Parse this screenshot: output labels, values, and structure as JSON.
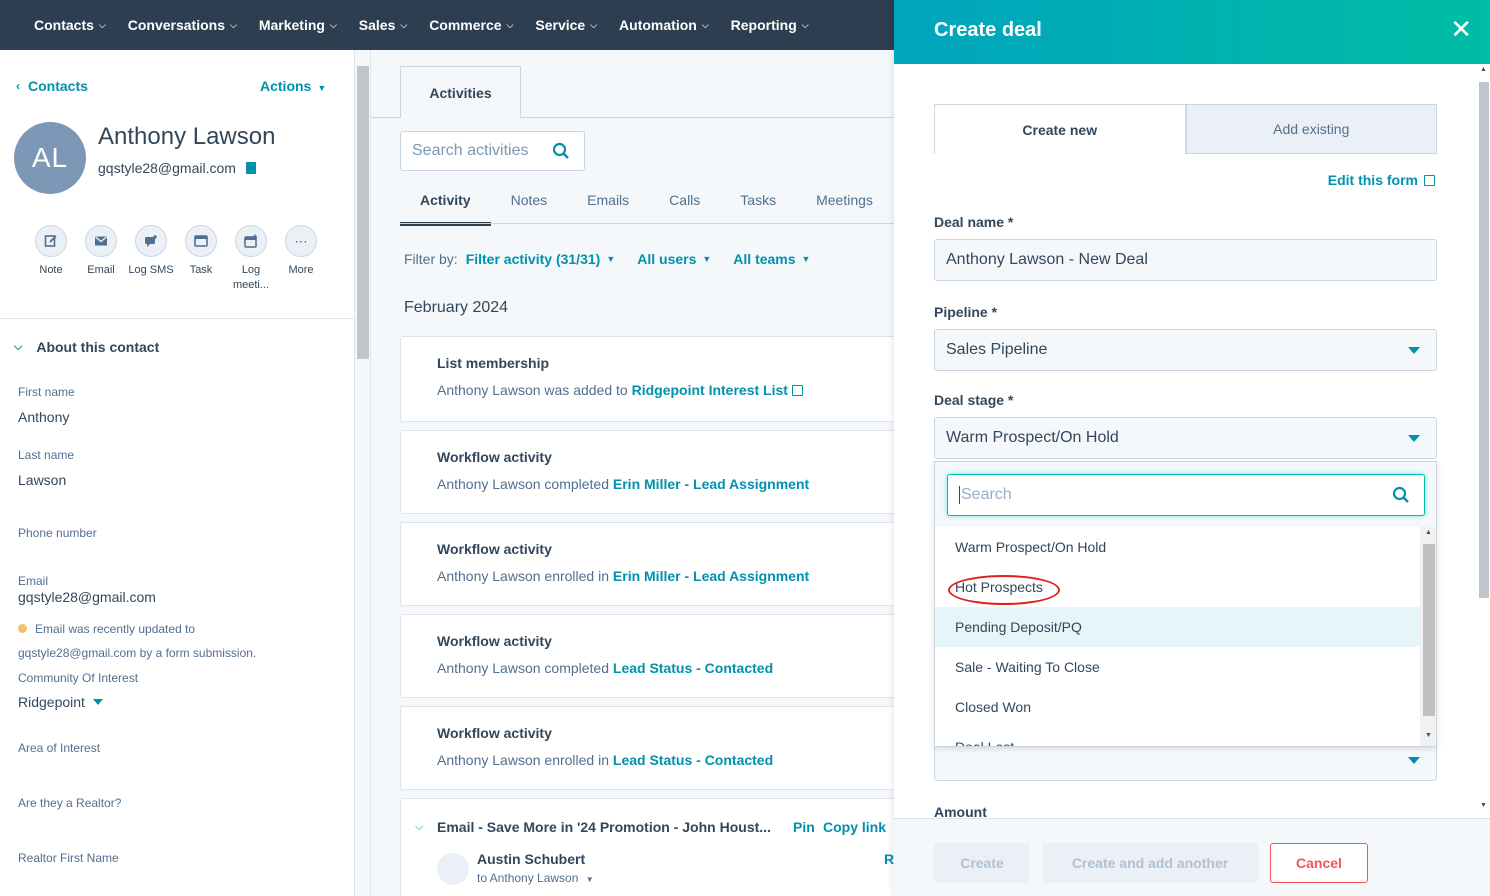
{
  "topnav": {
    "items": [
      "Contacts",
      "Conversations",
      "Marketing",
      "Sales",
      "Commerce",
      "Service",
      "Automation",
      "Reporting"
    ]
  },
  "contact": {
    "breadcrumb": "Contacts",
    "actions_label": "Actions",
    "initials": "AL",
    "name": "Anthony Lawson",
    "email": "gqstyle28@gmail.com"
  },
  "quick_actions": [
    {
      "label": "Note",
      "icon": "note-icon"
    },
    {
      "label": "Email",
      "icon": "email-icon"
    },
    {
      "label": "Log SMS",
      "icon": "log-sms-icon"
    },
    {
      "label": "Task",
      "icon": "task-icon"
    },
    {
      "label": "Log meeti...",
      "icon": "log-meeting-icon"
    },
    {
      "label": "More",
      "icon": "more-icon"
    }
  ],
  "about": {
    "heading": "About this contact",
    "first_name_label": "First name",
    "first_name": "Anthony",
    "last_name_label": "Last name",
    "last_name": "Lawson",
    "phone_label": "Phone number",
    "email_label": "Email",
    "email": "gqstyle28@gmail.com",
    "email_note_line1": "Email was recently updated to",
    "email_note_line2": "gqstyle28@gmail.com by a form submission.",
    "community_label": "Community Of Interest",
    "community": "Ridgepoint",
    "area_label": "Area of Interest",
    "realtor_label": "Are they a Realtor?",
    "realtor_first_label": "Realtor First Name"
  },
  "activities": {
    "tab": "Activities",
    "search_placeholder": "Search activities",
    "subtabs": [
      "Activity",
      "Notes",
      "Emails",
      "Calls",
      "Tasks",
      "Meetings"
    ],
    "filter_by": "Filter by:",
    "filter_activity": "Filter activity (31/31)",
    "all_users": "All users",
    "all_teams": "All teams",
    "month": "February 2024",
    "cards": [
      {
        "title": "List membership",
        "prefix": "Anthony Lawson was added to",
        "link": "Ridgepoint Interest List"
      },
      {
        "title": "Workflow activity",
        "prefix": "Anthony Lawson completed",
        "link": "Erin Miller - Lead Assignment"
      },
      {
        "title": "Workflow activity",
        "prefix": "Anthony Lawson enrolled in",
        "link": "Erin Miller - Lead Assignment"
      },
      {
        "title": "Workflow activity",
        "prefix": "Anthony Lawson completed",
        "link": "Lead Status - Contacted"
      },
      {
        "title": "Workflow activity",
        "prefix": "Anthony Lawson enrolled in",
        "link": "Lead Status - Contacted"
      }
    ],
    "email_card": {
      "title": "Email - Save More in '24 Promotion - John Houst...",
      "pin": "Pin",
      "copy_link": "Copy link",
      "author": "Austin Schubert",
      "to": "to Anthony Lawson",
      "r": "R"
    }
  },
  "panel": {
    "title": "Create deal",
    "tab_create": "Create new",
    "tab_existing": "Add existing",
    "edit_form": "Edit this form",
    "deal_name_label": "Deal name *",
    "deal_name": "Anthony Lawson - New Deal",
    "pipeline_label": "Pipeline *",
    "pipeline": "Sales Pipeline",
    "stage_label": "Deal stage *",
    "stage": "Warm Prospect/On Hold",
    "search_placeholder": "Search",
    "options": [
      "Warm Prospect/On Hold",
      "Hot Prospects",
      "Pending Deposit/PQ",
      "Sale - Waiting To Close",
      "Closed Won",
      "Deal Lost"
    ],
    "amount_label": "Amount",
    "btn_create": "Create",
    "btn_create_another": "Create and add another",
    "btn_cancel": "Cancel"
  },
  "colors": {
    "nav_bg": "#2d3e50",
    "accent": "#0091ae",
    "header_gradient_start": "#00a4bd",
    "header_gradient_end": "#00bda5",
    "cancel": "#f2545b",
    "annotation": "#e0201c"
  }
}
